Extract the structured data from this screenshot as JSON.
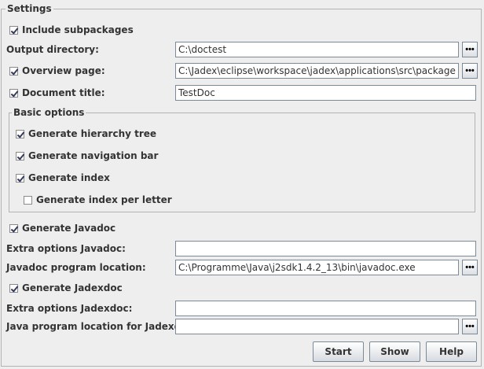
{
  "settings": {
    "legend": "Settings",
    "include_subpackages": {
      "label": "Include subpackages",
      "checked": true
    },
    "output_directory": {
      "label": "Output directory:",
      "value": "C:\\doctest"
    },
    "overview_page": {
      "label": "Overview page:",
      "checked": true,
      "value": "C:\\Jadex\\eclipse\\workspace\\jadex\\applications\\src\\package.html"
    },
    "document_title": {
      "label": "Document title:",
      "checked": true,
      "value": "TestDoc"
    }
  },
  "basic_options": {
    "legend": "Basic options",
    "hierarchy_tree": {
      "label": "Generate hierarchy tree",
      "checked": true
    },
    "navigation_bar": {
      "label": "Generate navigation bar",
      "checked": true
    },
    "index": {
      "label": "Generate index",
      "checked": true
    },
    "index_per_letter": {
      "label": "Generate index per letter",
      "checked": false
    }
  },
  "javadoc": {
    "generate": {
      "label": "Generate Javadoc",
      "checked": true
    },
    "extra_options": {
      "label": "Extra options Javadoc:",
      "value": ""
    },
    "program_location": {
      "label": "Javadoc program location:",
      "value": "C:\\Programme\\Java\\j2sdk1.4.2_13\\bin\\javadoc.exe"
    }
  },
  "jadexdoc": {
    "generate": {
      "label": "Generate Jadexdoc",
      "checked": true
    },
    "extra_options": {
      "label": "Extra options Jadexdoc:",
      "value": ""
    },
    "java_location": {
      "label": "Java program location for Jadexdoc:",
      "value": ""
    }
  },
  "browse_label": "•••",
  "buttons": {
    "start": "Start",
    "show": "Show",
    "help": "Help"
  },
  "colors": {
    "background": "#eeeeee",
    "border": "#b3b3b3",
    "check": "#333a5c",
    "field_border": "#7a8a99"
  }
}
